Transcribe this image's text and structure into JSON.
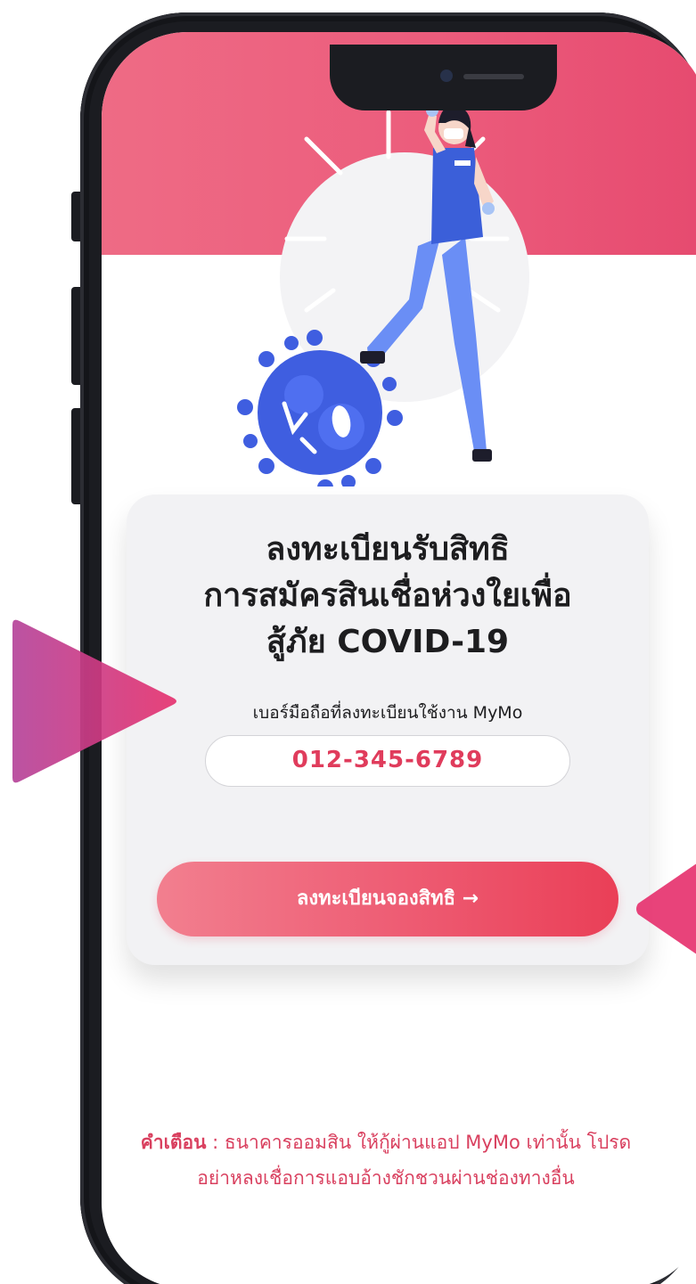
{
  "card": {
    "title": "ลงทะเบียนรับสิทธิ\nการสมัครสินเชื่อห่วงใยเพื่อ\nสู้ภัย COVID-19",
    "phone_label": "เบอร์มือถือที่ลงทะเบียนใช้งาน MyMo",
    "phone_value": "012-345-6789",
    "register_button_label": "ลงทะเบียนจองสิทธิ →"
  },
  "warning": {
    "label": "คำเตือน",
    "separator": " : ",
    "text": "ธนาคารออมสิน ให้กู้ผ่านแอป MyMo เท่านั้น โปรดอย่าหลงเชื่อการแอบอ้างชักชวนผ่านช่องทางอื่น"
  },
  "colors": {
    "header_pink": "#ec5c7c",
    "accent_red": "#e03c5c",
    "button_gradient_start": "#f27f8f",
    "button_gradient_end": "#ea3f57",
    "triangle_purple": "#b73a97"
  },
  "icons": {
    "hero": "nurse-stepping-on-virus-illustration",
    "button_arrow": "arrow-right-icon"
  }
}
